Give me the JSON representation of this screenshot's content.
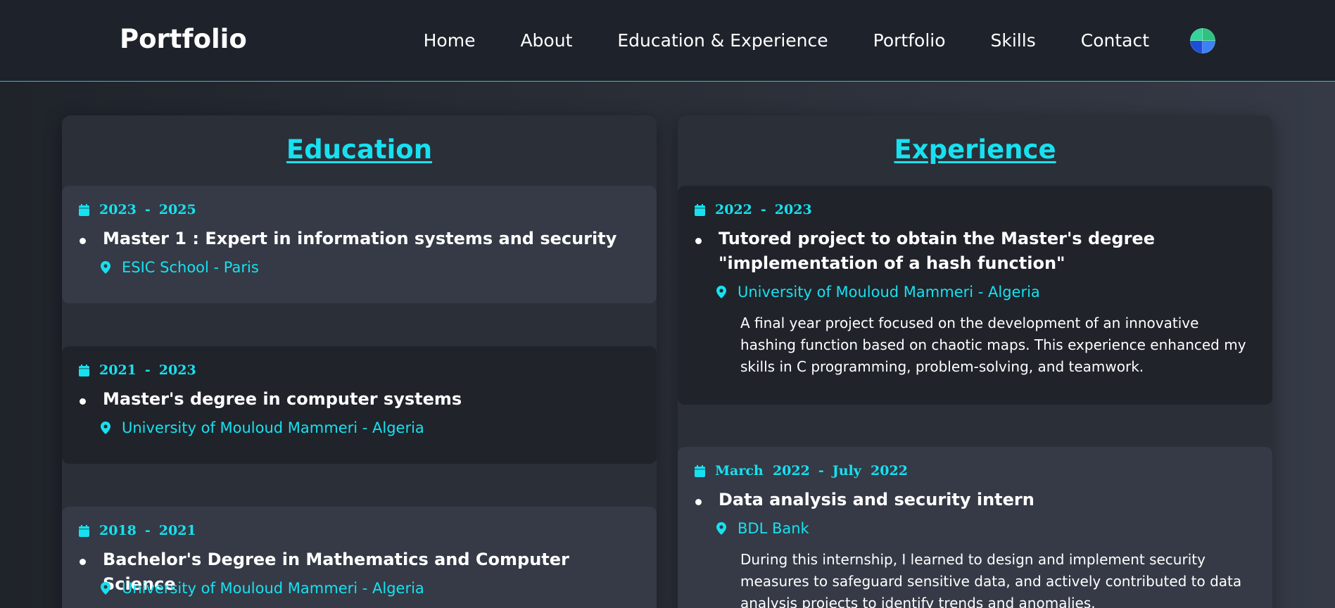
{
  "nav": {
    "brand": "Portfolio",
    "links": [
      "Home",
      "About",
      "Education & Experience",
      "Portfolio",
      "Skills",
      "Contact"
    ],
    "theme_icon": "globe-icon"
  },
  "colors": {
    "accent": "#17e1f0",
    "nav_bg": "#1e222a",
    "card_light": "#353a46",
    "card_dark": "#20232a"
  },
  "education": {
    "heading": "Education",
    "items": [
      {
        "start": "2023",
        "end": "2025",
        "title": "Master 1 : Expert in information systems and security",
        "place": "ESIC School - Paris"
      },
      {
        "start": "2021",
        "end": "2023",
        "title": "Master's degree in computer systems",
        "place": "University of Mouloud Mammeri - Algeria"
      },
      {
        "start": "2018",
        "end": "2021",
        "title": "Bachelor's Degree in Mathematics and Computer Science",
        "place": "University of Mouloud Mammeri - Algeria"
      }
    ]
  },
  "experience": {
    "heading": "Experience",
    "items": [
      {
        "start": "2022",
        "end": "2023",
        "title": "Tutored project to obtain the Master's degree \"implementation of a hash function\"",
        "place": "University of Mouloud Mammeri - Algeria",
        "description": "A final year project focused on the development of an innovative hashing function based on chaotic maps. This experience enhanced my skills in C programming, problem-solving, and teamwork."
      },
      {
        "start": "March  2022",
        "end": "July  2022",
        "title": "Data analysis and security intern",
        "place": "BDL Bank",
        "description": "During this internship, I learned to design and implement security measures to safeguard sensitive data, and actively contributed to data analysis projects to identify trends and anomalies."
      }
    ]
  }
}
